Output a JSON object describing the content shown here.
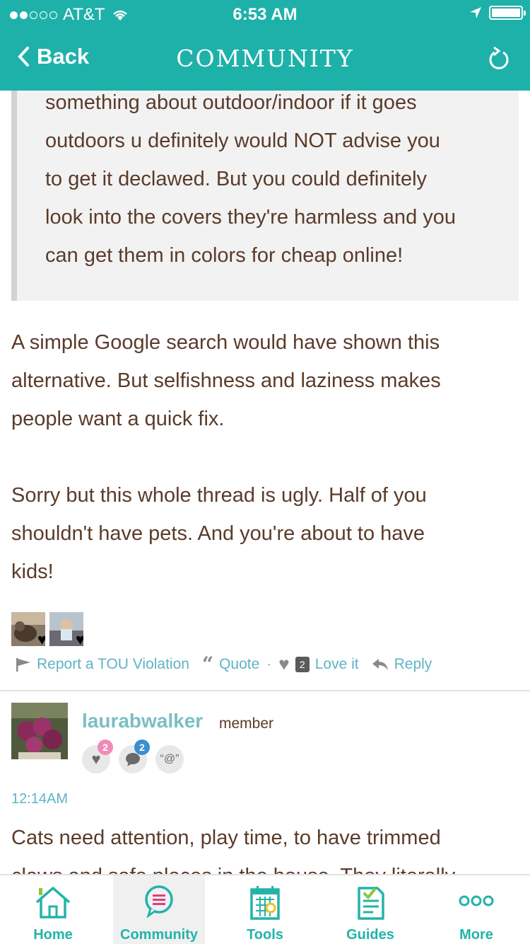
{
  "status": {
    "carrier": "AT&T",
    "time": "6:53 AM"
  },
  "nav": {
    "back": "Back",
    "title": "COMMUNITY"
  },
  "quote_lines": [
    "something about outdoor/indoor if it goes",
    "outdoors u definitely would NOT advise you",
    "to get it declawed. But you could definitely",
    "look into the covers they're harmless and you",
    "can get them in colors for cheap online!"
  ],
  "post_lines_1": [
    "A simple Google search would have shown this",
    "alternative. But selfishness and laziness makes",
    "people want a quick fix."
  ],
  "post_lines_2": [
    "Sorry but this whole thread is ugly. Half of you",
    "shouldn't have pets. And you're about to have",
    "kids!"
  ],
  "actions": {
    "report": "Report a TOU Violation",
    "quote": "Quote",
    "love_count": "2",
    "love": "Love it",
    "reply": "Reply",
    "dot": "·"
  },
  "next_post": {
    "username": "laurabwalker",
    "role": "member",
    "badge_love": "2",
    "badge_comment": "2",
    "badge_mention": "“@”",
    "time": "12:14AM",
    "line1": "Cats need attention, play time, to have trimmed",
    "line2": "claws and safe places in the house. They literally"
  },
  "tabs": {
    "home": "Home",
    "community": "Community",
    "tools": "Tools",
    "guides": "Guides",
    "more": "More"
  },
  "colors": {
    "teal": "#1eb1aa",
    "link": "#5fb3c6",
    "text": "#5a3b2a"
  }
}
